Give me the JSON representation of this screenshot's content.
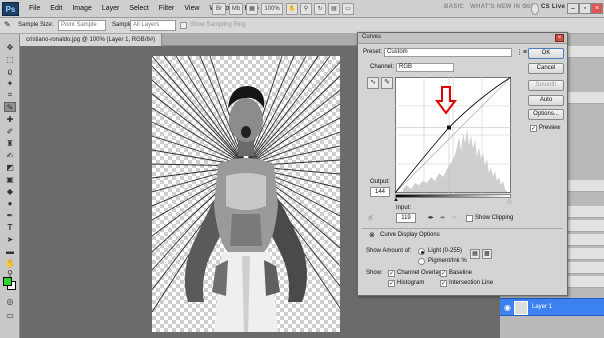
{
  "menubar": {
    "logo": "Ps",
    "menus": [
      "File",
      "Edit",
      "Image",
      "Layer",
      "Select",
      "Filter",
      "View",
      "Window",
      "Help"
    ],
    "zoom": "100%",
    "workspace_basic": "BASIC",
    "workspace_new": "WHAT'S NEW IN CS5",
    "live": "CS Live"
  },
  "options": {
    "sample_size_label": "Sample Size:",
    "sample_size_value": "Point Sample",
    "sample_label": "Sample:",
    "sample_value": "All Layers",
    "sampling_ring_label": "Show Sampling Ring"
  },
  "document": {
    "tab_title": "cristiano-ronaldo.jpg @ 100% (Layer 1, RGB/8#)"
  },
  "curves": {
    "title": "Curves",
    "preset_label": "Preset:",
    "preset_value": "Custom",
    "channel_label": "Channel:",
    "channel_value": "RGB",
    "output_label": "Output:",
    "output_value": "144",
    "input_label": "Input:",
    "input_value": "119",
    "show_clipping_label": "Show Clipping",
    "display_options_label": "Curve Display Options",
    "show_amount_label": "Show Amount of:",
    "light_label": "Light (0-255)",
    "pigment_label": "Pigment/Ink %",
    "show_label": "Show:",
    "channel_overlays_label": "Channel Overlays",
    "baseline_label": "Baseline",
    "histogram_label": "Histogram",
    "intersection_label": "Intersection Line",
    "buttons": {
      "ok": "OK",
      "cancel": "Cancel",
      "smooth": "Smooth",
      "auto": "Auto",
      "options": "Options..."
    },
    "preview_label": "Preview",
    "light_selected": true,
    "checkmarks": {
      "channel_overlays": true,
      "baseline": true,
      "histogram": true,
      "intersection": true,
      "show_clipping": false,
      "preview": true
    },
    "annotation_color": "#e00000"
  },
  "layers": {
    "row_name": "Layer 1"
  }
}
